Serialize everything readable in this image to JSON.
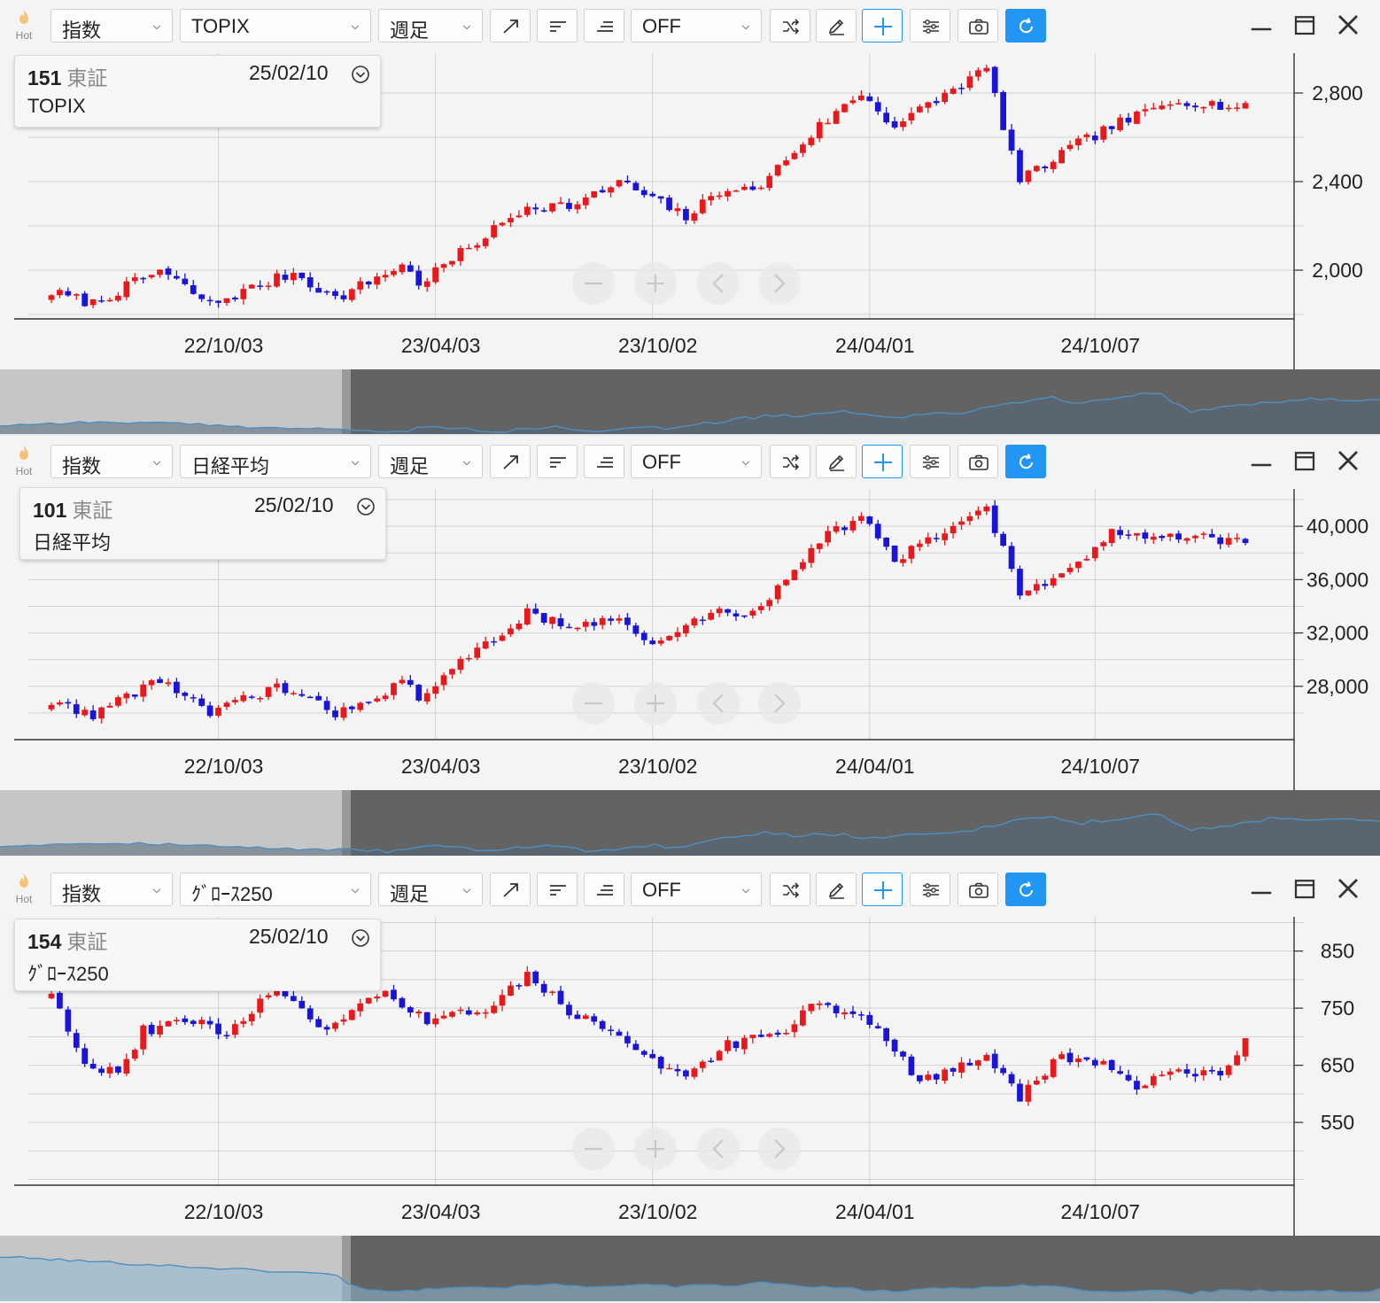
{
  "toolbar": {
    "hot_label": "Hot",
    "category": "指数",
    "timeframe": "週足",
    "indicator": "OFF"
  },
  "colors": {
    "up": "#e8191c",
    "down": "#1a14d6",
    "accent": "#2196f3",
    "navigator_dark": "#636363",
    "navigator_light": "#c6c6c6",
    "navigator_line": "#4d8fc0"
  },
  "x_axis": {
    "ticks": [
      "22/10/03",
      "23/04/03",
      "23/10/02",
      "24/04/01",
      "24/10/07"
    ]
  },
  "zoom_controls": [
    "zoom-out",
    "zoom-in",
    "scroll-left",
    "scroll-right"
  ],
  "panels": [
    {
      "symbol": "TOPIX",
      "code": "151",
      "market": "東証",
      "date": "25/02/10",
      "name": "TOPIX",
      "y_ticks": [
        "2,000",
        "2,400",
        "2,800"
      ],
      "chart_data": {
        "type": "candlestick",
        "interval": "weekly",
        "x_range": [
          "2022-05-16",
          "2025-02-10"
        ],
        "ylim": [
          1780,
          2980
        ],
        "y_ticks": [
          2000,
          2400,
          2800
        ],
        "anchors": [
          [
            "2022-05-16",
            1900
          ],
          [
            "2022-06-20",
            1850
          ],
          [
            "2022-08-15",
            2000
          ],
          [
            "2022-09-26",
            1845
          ],
          [
            "2022-12-05",
            1990
          ],
          [
            "2023-01-09",
            1870
          ],
          [
            "2023-03-06",
            2025
          ],
          [
            "2023-03-20",
            1940
          ],
          [
            "2023-06-19",
            2290
          ],
          [
            "2023-07-31",
            2295
          ],
          [
            "2023-09-04",
            2400
          ],
          [
            "2023-10-30",
            2240
          ],
          [
            "2023-12-04",
            2380
          ],
          [
            "2023-12-25",
            2350
          ],
          [
            "2024-02-19",
            2650
          ],
          [
            "2024-03-25",
            2800
          ],
          [
            "2024-04-22",
            2650
          ],
          [
            "2024-07-08",
            2910
          ],
          [
            "2024-08-05",
            2400
          ],
          [
            "2024-09-16",
            2550
          ],
          [
            "2024-10-21",
            2650
          ],
          [
            "2024-12-16",
            2770
          ],
          [
            "2025-02-10",
            2730
          ]
        ]
      }
    },
    {
      "symbol": "日経平均",
      "code": "101",
      "market": "東証",
      "date": "25/02/10",
      "name": "日経平均",
      "y_ticks": [
        "28,000",
        "32,000",
        "36,000",
        "40,000"
      ],
      "chart_data": {
        "type": "candlestick",
        "interval": "weekly",
        "x_range": [
          "2022-05-16",
          "2025-02-10"
        ],
        "ylim": [
          24000,
          42800
        ],
        "y_ticks": [
          28000,
          32000,
          36000,
          40000
        ],
        "anchors": [
          [
            "2022-05-16",
            26800
          ],
          [
            "2022-06-20",
            25900
          ],
          [
            "2022-08-15",
            28600
          ],
          [
            "2022-09-26",
            25900
          ],
          [
            "2022-11-21",
            28000
          ],
          [
            "2023-01-09",
            26000
          ],
          [
            "2023-03-06",
            28200
          ],
          [
            "2023-03-20",
            27300
          ],
          [
            "2023-06-19",
            33500
          ],
          [
            "2023-07-31",
            32500
          ],
          [
            "2023-09-04",
            33000
          ],
          [
            "2023-10-02",
            31000
          ],
          [
            "2023-11-20",
            33600
          ],
          [
            "2023-12-25",
            33400
          ],
          [
            "2024-02-19",
            39000
          ],
          [
            "2024-03-25",
            40800
          ],
          [
            "2024-04-22",
            37400
          ],
          [
            "2024-07-08",
            41500
          ],
          [
            "2024-08-05",
            35000
          ],
          [
            "2024-09-16",
            36500
          ],
          [
            "2024-10-21",
            39500
          ],
          [
            "2024-12-16",
            39400
          ],
          [
            "2025-02-10",
            38800
          ]
        ]
      }
    },
    {
      "symbol": "ｸﾞﾛｰｽ250",
      "code": "154",
      "market": "東証",
      "date": "25/02/10",
      "name": "ｸﾞﾛｰｽ250",
      "y_ticks": [
        "550",
        "650",
        "750",
        "850"
      ],
      "chart_data": {
        "type": "candlestick",
        "interval": "weekly",
        "x_range": [
          "2022-05-16",
          "2025-02-10"
        ],
        "ylim": [
          440,
          910
        ],
        "y_ticks": [
          550,
          650,
          750,
          850
        ],
        "anchors": [
          [
            "2022-05-16",
            780
          ],
          [
            "2022-06-13",
            655
          ],
          [
            "2022-07-11",
            635
          ],
          [
            "2022-08-01",
            710
          ],
          [
            "2022-09-05",
            730
          ],
          [
            "2022-10-10",
            705
          ],
          [
            "2022-11-21",
            790
          ],
          [
            "2022-12-26",
            710
          ],
          [
            "2023-02-20",
            775
          ],
          [
            "2023-03-27",
            730
          ],
          [
            "2023-05-15",
            745
          ],
          [
            "2023-06-05",
            780
          ],
          [
            "2023-06-19",
            815
          ],
          [
            "2023-07-24",
            745
          ],
          [
            "2023-09-04",
            700
          ],
          [
            "2023-10-23",
            630
          ],
          [
            "2023-12-04",
            685
          ],
          [
            "2024-01-15",
            705
          ],
          [
            "2024-02-19",
            760
          ],
          [
            "2024-04-01",
            730
          ],
          [
            "2024-05-13",
            620
          ],
          [
            "2024-06-10",
            640
          ],
          [
            "2024-07-08",
            670
          ],
          [
            "2024-08-05",
            595
          ],
          [
            "2024-09-09",
            665
          ],
          [
            "2024-10-14",
            650
          ],
          [
            "2024-11-11",
            615
          ],
          [
            "2024-12-09",
            635
          ],
          [
            "2025-01-20",
            642
          ],
          [
            "2025-02-10",
            690
          ]
        ]
      }
    }
  ]
}
